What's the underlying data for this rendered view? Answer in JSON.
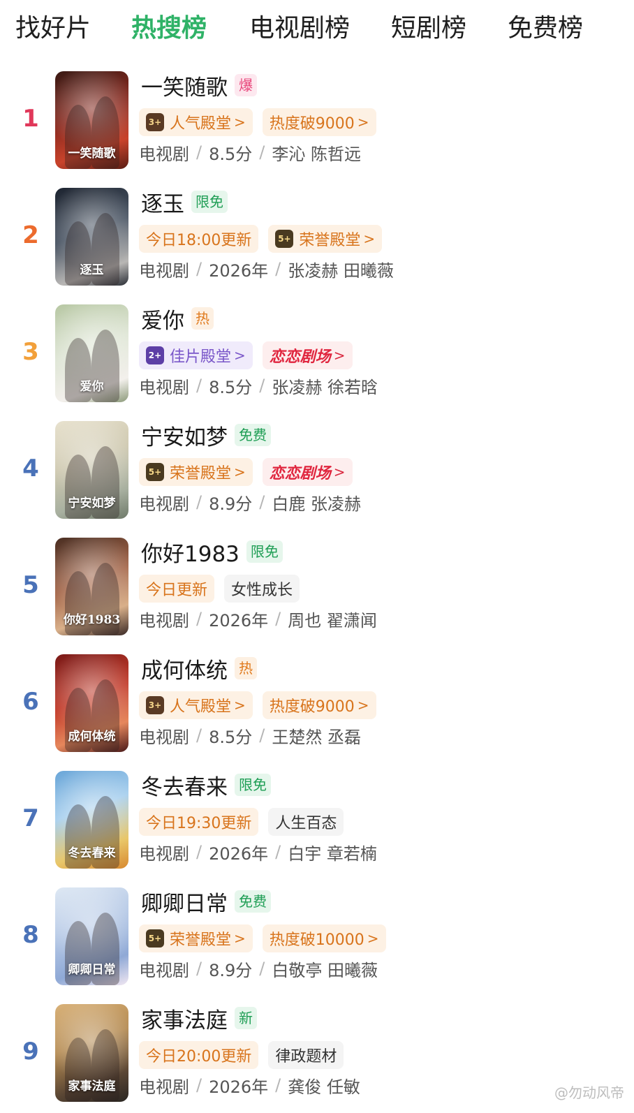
{
  "tabs": [
    {
      "label": "找好片",
      "active": false
    },
    {
      "label": "热搜榜",
      "active": true
    },
    {
      "label": "电视剧榜",
      "active": false
    },
    {
      "label": "短剧榜",
      "active": false
    },
    {
      "label": "免费榜",
      "active": false
    }
  ],
  "colors": {
    "active_tab": "#2fb267",
    "rank_1": "#e0385a",
    "rank_2": "#ec6b2d",
    "rank_3": "#f2a03a",
    "rank_rest": "#4a72b8"
  },
  "items": [
    {
      "rank": "1",
      "title": "一笑随歌",
      "tag": "爆",
      "badges": [
        {
          "medal": "3+",
          "label": "人气殿堂",
          "arrow": ">"
        },
        {
          "label": "热度破9000",
          "arrow": ">"
        }
      ],
      "meta": {
        "type": "电视剧",
        "info": "8.5分",
        "cast": "李沁 陈哲远"
      }
    },
    {
      "rank": "2",
      "title": "逐玉",
      "tag": "限免",
      "badges": [
        {
          "label": "今日18:00更新"
        },
        {
          "medal": "5+",
          "label": "荣誉殿堂",
          "arrow": ">"
        }
      ],
      "meta": {
        "type": "电视剧",
        "info": "2026年",
        "cast": "张凌赫 田曦薇"
      }
    },
    {
      "rank": "3",
      "title": "爱你",
      "tag": "热",
      "badges": [
        {
          "medal": "2+",
          "label": "佳片殿堂",
          "arrow": ">"
        },
        {
          "label": "恋恋剧场",
          "arrow": ">"
        }
      ],
      "meta": {
        "type": "电视剧",
        "info": "8.5分",
        "cast": "张凌赫 徐若晗"
      }
    },
    {
      "rank": "4",
      "title": "宁安如梦",
      "tag": "免费",
      "badges": [
        {
          "medal": "5+",
          "label": "荣誉殿堂",
          "arrow": ">"
        },
        {
          "label": "恋恋剧场",
          "arrow": ">"
        }
      ],
      "meta": {
        "type": "电视剧",
        "info": "8.9分",
        "cast": "白鹿 张凌赫"
      }
    },
    {
      "rank": "5",
      "title": "你好1983",
      "tag": "限免",
      "badges": [
        {
          "label": "今日更新"
        },
        {
          "label": "女性成长"
        }
      ],
      "meta": {
        "type": "电视剧",
        "info": "2026年",
        "cast": "周也 翟潇闻"
      }
    },
    {
      "rank": "6",
      "title": "成何体统",
      "tag": "热",
      "badges": [
        {
          "medal": "3+",
          "label": "人气殿堂",
          "arrow": ">"
        },
        {
          "label": "热度破9000",
          "arrow": ">"
        }
      ],
      "meta": {
        "type": "电视剧",
        "info": "8.5分",
        "cast": "王楚然 丞磊"
      }
    },
    {
      "rank": "7",
      "title": "冬去春来",
      "tag": "限免",
      "badges": [
        {
          "label": "今日19:30更新"
        },
        {
          "label": "人生百态"
        }
      ],
      "meta": {
        "type": "电视剧",
        "info": "2026年",
        "cast": "白宇 章若楠"
      }
    },
    {
      "rank": "8",
      "title": "卿卿日常",
      "tag": "免费",
      "badges": [
        {
          "medal": "5+",
          "label": "荣誉殿堂",
          "arrow": ">"
        },
        {
          "label": "热度破10000",
          "arrow": ">"
        }
      ],
      "meta": {
        "type": "电视剧",
        "info": "8.9分",
        "cast": "白敬亭 田曦薇"
      }
    },
    {
      "rank": "9",
      "title": "家事法庭",
      "tag": "新",
      "badges": [
        {
          "label": "今日20:00更新"
        },
        {
          "label": "律政题材"
        }
      ],
      "meta": {
        "type": "电视剧",
        "info": "2026年",
        "cast": "龚俊 任敏"
      }
    }
  ],
  "posters": [
    "一笑随歌",
    "逐玉",
    "爱你",
    "宁安如梦",
    "你好1983",
    "成何体统",
    "冬去春来",
    "卿卿日常",
    "家事法庭"
  ],
  "watermark": "@勿动风帝"
}
